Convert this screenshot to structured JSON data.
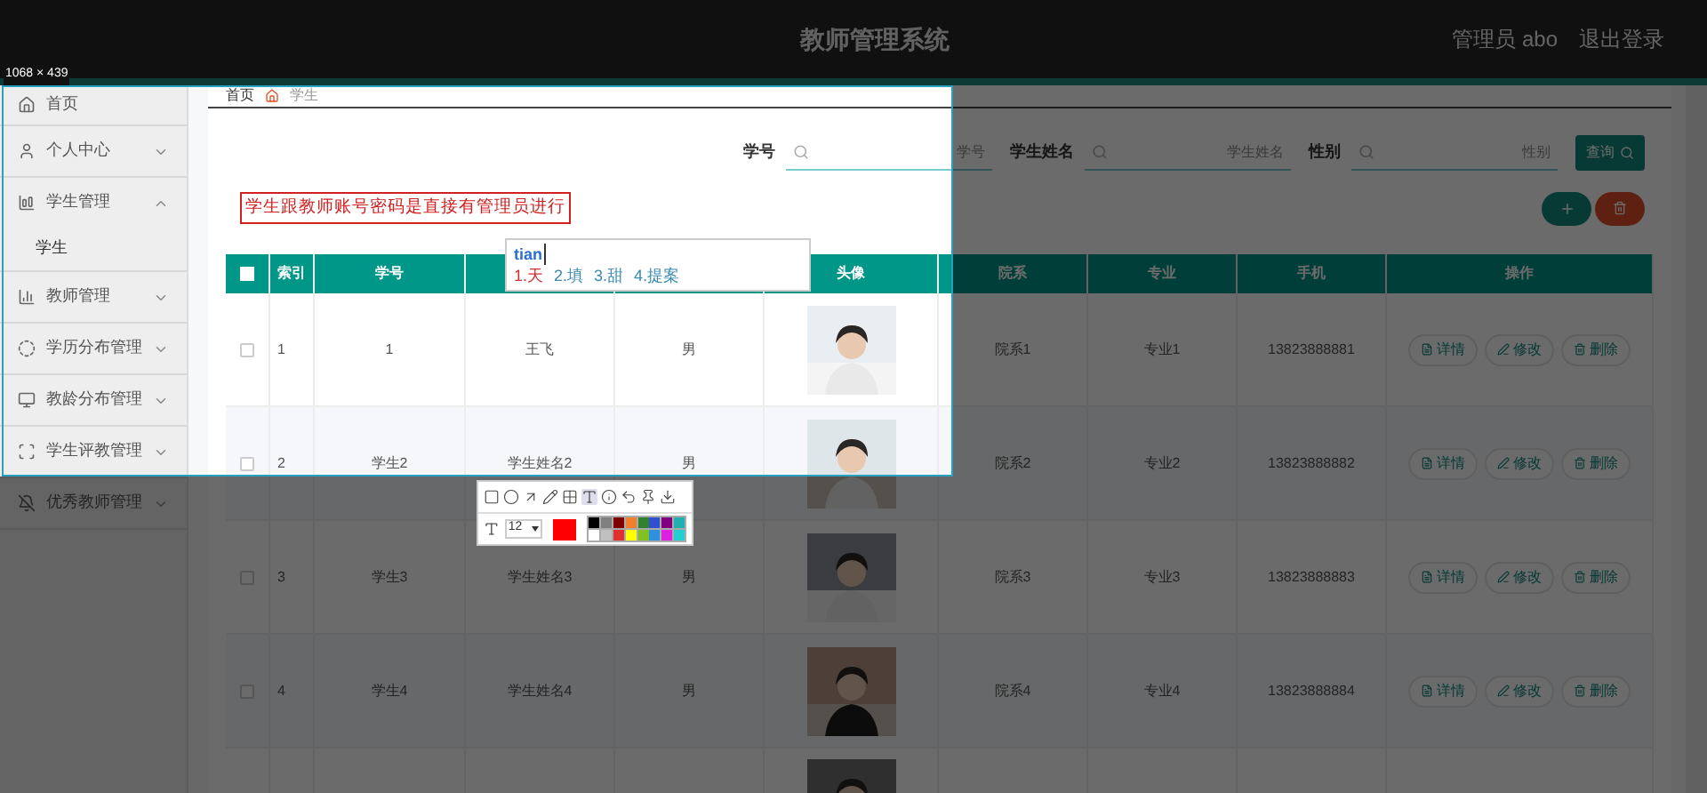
{
  "header": {
    "title": "教师管理系统",
    "user": "管理员 abo",
    "logout": "退出登录"
  },
  "capture": {
    "size_label": "1068 × 439"
  },
  "sidebar": {
    "items": [
      {
        "label": "首页"
      },
      {
        "label": "个人中心",
        "expanded": false
      },
      {
        "label": "学生管理",
        "expanded": true,
        "children": [
          {
            "label": "学生"
          }
        ]
      },
      {
        "label": "教师管理",
        "expanded": false
      },
      {
        "label": "学历分布管理",
        "expanded": false
      },
      {
        "label": "教龄分布管理",
        "expanded": false
      },
      {
        "label": "学生评教管理",
        "expanded": false
      },
      {
        "label": "优秀教师管理",
        "expanded": false
      }
    ]
  },
  "breadcrumb": [
    "首页",
    "学生"
  ],
  "search": {
    "fields": [
      {
        "label": "学号",
        "placeholder": "学号"
      },
      {
        "label": "学生姓名",
        "placeholder": "学生姓名"
      },
      {
        "label": "性别",
        "placeholder": "性别"
      }
    ],
    "button": "查询"
  },
  "annotation": {
    "text": "学生跟教师账号密码是直接有管理员进行"
  },
  "ime": {
    "input": "tian",
    "candidates": [
      {
        "text": "1.天",
        "selected": true
      },
      {
        "text": "2.填",
        "selected": false
      },
      {
        "text": "3.甜",
        "selected": false
      },
      {
        "text": "4.提案",
        "selected": false
      }
    ]
  },
  "table": {
    "header_checked": false,
    "columns_left": [
      "索引",
      "学号"
    ],
    "columns_right": [
      "头像",
      "院系",
      "专业",
      "手机",
      "操作"
    ],
    "rows": [
      {
        "checked": false,
        "index": "1",
        "id": "1",
        "name": "王飞",
        "gender": "男",
        "department": "院系1",
        "major": "专业1",
        "phone": "13823888881",
        "actions": [
          "详情",
          "修改",
          "删除"
        ]
      },
      {
        "checked": false,
        "index": "2",
        "id": "学生2",
        "name": "学生姓名2",
        "gender": "男",
        "department": "院系2",
        "major": "专业2",
        "phone": "13823888882",
        "actions": [
          "详情",
          "修改",
          "删除"
        ]
      },
      {
        "checked": false,
        "index": "3",
        "id": "学生3",
        "name": "学生姓名3",
        "gender": "男",
        "department": "院系3",
        "major": "专业3",
        "phone": "13823888883",
        "actions": [
          "详情",
          "修改",
          "删除"
        ]
      },
      {
        "checked": false,
        "index": "4",
        "id": "学生4",
        "name": "学生姓名4",
        "gender": "男",
        "department": "院系4",
        "major": "专业4",
        "phone": "13823888884",
        "actions": [
          "详情",
          "修改",
          "删除"
        ]
      },
      {
        "kind": "cut"
      }
    ]
  },
  "toolbar": {
    "tools": [
      {
        "selected": false
      },
      {
        "selected": false
      },
      {
        "selected": false
      },
      {
        "selected": false
      },
      {
        "selected": false
      },
      {
        "selected": true
      },
      {
        "selected": false
      },
      {
        "selected": false
      },
      {
        "selected": false
      },
      {
        "selected": false
      }
    ],
    "font_size": "12",
    "current_swatch": {
      "color": "#ff0000"
    },
    "palette": [
      {
        "color": "#000000"
      },
      {
        "color": "#808080"
      },
      {
        "color": "#800000"
      },
      {
        "color": "#f08030"
      },
      {
        "color": "#308030"
      },
      {
        "color": "#3050d0"
      },
      {
        "color": "#800080"
      },
      {
        "color": "#20b0b0"
      },
      {
        "color": "#ffffff"
      },
      {
        "color": "#c0c0c0"
      },
      {
        "color": "#e03030"
      },
      {
        "color": "#ffff00"
      },
      {
        "color": "#80c020"
      },
      {
        "color": "#3090e0"
      },
      {
        "color": "#e020e0"
      },
      {
        "color": "#20d0d0"
      }
    ]
  }
}
